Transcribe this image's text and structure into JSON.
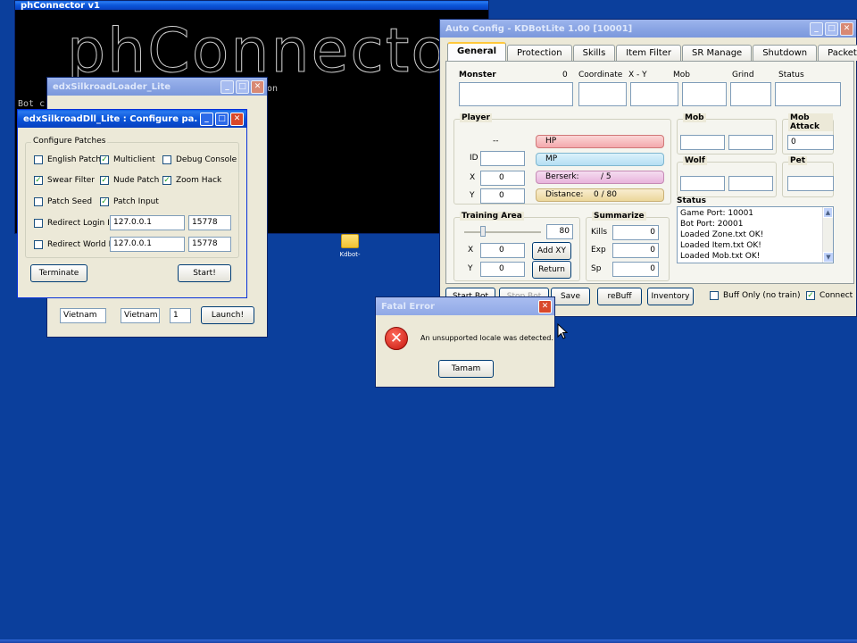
{
  "console": {
    "title": "phConnector v1",
    "ascii_banner": "phConnector",
    "line_partial_1": "Bot c",
    "line_partial_2": "on",
    "line_partial_3": "Bot c"
  },
  "loader": {
    "title": "edxSilkroadLoader_Lite",
    "locale_1": "Vietnam",
    "locale_2": "Vietnam",
    "locale_num": "1",
    "launch_label": "Launch!"
  },
  "configure": {
    "title": "edxSilkroadDll_Lite : Configure pa...",
    "group_title": "Configure Patches",
    "checkboxes": [
      {
        "label": "English Patch",
        "checked": false
      },
      {
        "label": "Multiclient",
        "checked": true
      },
      {
        "label": "Debug Console",
        "checked": false
      },
      {
        "label": "Swear Filter",
        "checked": true
      },
      {
        "label": "Nude Patch",
        "checked": true
      },
      {
        "label": "Zoom Hack",
        "checked": true
      },
      {
        "label": "Patch Seed",
        "checked": false
      },
      {
        "label": "Patch Input",
        "checked": true
      },
      {
        "label": "Redirect Login IP",
        "checked": false
      },
      {
        "label": "Redirect World IP",
        "checked": false
      }
    ],
    "login_ip": "127.0.0.1",
    "login_port": "15778",
    "world_ip": "127.0.0.1",
    "world_port": "15778",
    "terminate_label": "Terminate",
    "start_label": "Start!"
  },
  "autocfg": {
    "title": "Auto Config - KDBotLite 1.00 [10001]",
    "tabs": [
      "General",
      "Protection",
      "Skills",
      "Item Filter",
      "SR Manage",
      "Shutdown",
      "Packet"
    ],
    "monster": {
      "label": "Monster",
      "count": "0",
      "coordinate": "Coordinate",
      "xy": "X - Y",
      "mob": "Mob",
      "grind": "Grind",
      "status": "Status"
    },
    "player": {
      "label": "Player",
      "dash": "--",
      "id_label": "ID",
      "x_label": "X",
      "x_value": "0",
      "y_label": "Y",
      "y_value": "0",
      "hp": "HP",
      "mp": "MP",
      "berserk": "Berserk:",
      "berserk_value": "/ 5",
      "distance": "Distance:",
      "distance_value": "0 / 80"
    },
    "mob_label": "Mob",
    "mob_attack_label": "Mob Attack",
    "mob_attack_value": "0",
    "wolf_label": "Wolf",
    "pet_label": "Pet",
    "training": {
      "label": "Training Area",
      "range": "80",
      "x_label": "X",
      "x_value": "0",
      "y_label": "Y",
      "y_value": "0",
      "add_xy": "Add XY",
      "return": "Return"
    },
    "summarize": {
      "label": "Summarize",
      "kills_label": "Kills",
      "kills": "0",
      "exp_label": "Exp",
      "exp": "0",
      "sp_label": "Sp",
      "sp": "0"
    },
    "status": {
      "label": "Status",
      "lines": [
        "Game Port: 10001",
        "Bot Port: 20001",
        "Loaded Zone.txt OK!",
        "Loaded Item.txt OK!",
        "Loaded Mob.txt OK!"
      ]
    },
    "bottom": {
      "start_bot": "Start Bot",
      "stop_bot": "Stop Bot",
      "save": "Save",
      "rebuff": "reBuff",
      "inventory": "Inventory",
      "buff_only": "Buff Only (no train)",
      "connect": "Connect"
    }
  },
  "fatal": {
    "title": "Fatal Error",
    "message": "An unsupported locale was detected.",
    "ok_label": "Tamam"
  },
  "desktop_icon": {
    "label": "Kdbot-"
  }
}
